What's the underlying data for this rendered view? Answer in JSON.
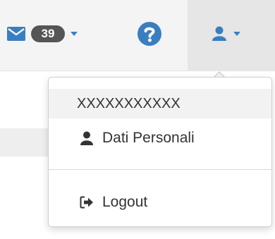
{
  "navbar": {
    "messages": {
      "icon": "envelope-icon",
      "count": "39"
    },
    "help": {
      "icon": "question-circle-icon"
    },
    "user": {
      "icon": "user-icon"
    }
  },
  "dropdown": {
    "header": "XXXXXXXXXXX",
    "items": [
      {
        "label": "Dati Personali",
        "icon": "user-icon"
      },
      {
        "label": "Logout",
        "icon": "sign-out-icon"
      }
    ]
  },
  "colors": {
    "accent": "#3a7ebf",
    "badge": "#555555",
    "icon_dark": "#333333"
  }
}
